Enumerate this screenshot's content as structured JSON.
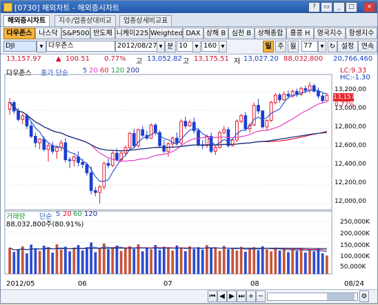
{
  "window": {
    "title": "[0730] 해외차트 - 해외증시차트",
    "controls": [
      "?",
      "▭",
      "_",
      "□",
      "×"
    ]
  },
  "tabs": [
    {
      "label": "해외증시차트",
      "active": true
    },
    {
      "label": "지수/업종상대비교",
      "active": false
    },
    {
      "label": "업종상세비교표",
      "active": false
    }
  ],
  "markets": [
    {
      "label": "다우존스",
      "selected": true
    },
    {
      "label": "나스닥"
    },
    {
      "label": "S&P500"
    },
    {
      "label": "반도체"
    },
    {
      "label": "니케이225"
    },
    {
      "label": "Weighted"
    },
    {
      "label": "DAX"
    },
    {
      "label": "상해 B"
    },
    {
      "label": "심천 B"
    },
    {
      "label": "상해종합"
    },
    {
      "label": "홍콩 H"
    },
    {
      "label": "영국지수"
    },
    {
      "label": "항셍지수"
    }
  ],
  "toolbar": {
    "symbol_code": "DJI",
    "symbol_name": "다우존스",
    "date": "2012/08/27",
    "period": "분",
    "minutes": "10",
    "count": "160",
    "day": "일",
    "week": "주",
    "month": "월",
    "span": "77",
    "settings": "설정",
    "continuous": "연속"
  },
  "quote": {
    "price": "13,157.97",
    "change": "100.51",
    "change_pct": "0.77%",
    "high_label": "고",
    "high": "13,052.82",
    "open_label": "고",
    "open": "13,175.51",
    "low_label": "저",
    "low": "13,027.20",
    "value": "88,032,800",
    "volume": "20,766,460"
  },
  "price_panel": {
    "legend_title": "다우존스",
    "legend_type": "종가 단순",
    "ma": [
      {
        "period": "5",
        "color": "#2b57c8"
      },
      {
        "period": "20",
        "color": "#e040c0"
      },
      {
        "period": "60",
        "color": "#e3132b"
      },
      {
        "period": "120",
        "color": "#1a9a3a"
      },
      {
        "period": "200",
        "color": "#1a2a8a"
      }
    ],
    "lc": "LC:9.33",
    "hc": "HC:-1.30",
    "last_tag": "13,157.97",
    "last_pct": "0.77%",
    "ticks": [
      "13,200,00",
      "13,000,00",
      "12,800,00",
      "12,600,00",
      "12,400,00",
      "12,200,00",
      "12,000,00"
    ]
  },
  "volume_panel": {
    "legend_title": "거래량",
    "legend_type": "단순",
    "ma": [
      {
        "period": "5",
        "color": "#2b57c8"
      },
      {
        "period": "20",
        "color": "#e3132b"
      },
      {
        "period": "60",
        "color": "#1a9a3a"
      },
      {
        "period": "120",
        "color": "#1a2a8a"
      }
    ],
    "info": "88,032,800주(80.91%)",
    "ticks": [
      "250,000K",
      "200,000K",
      "150,000K",
      "100,000K",
      "50,000K"
    ]
  },
  "xaxis": {
    "labels": [
      "2012/05",
      "06",
      "07",
      "08"
    ],
    "end": "08/24"
  },
  "chart_data": [
    {
      "type": "candlestick",
      "title": "다우존스",
      "ylim": [
        11950,
        13350
      ],
      "candles": [
        [
          13010,
          13130,
          12950,
          13080
        ],
        [
          13080,
          13100,
          12960,
          12990
        ],
        [
          12990,
          13020,
          12880,
          12900
        ],
        [
          12900,
          12960,
          12850,
          12940
        ],
        [
          12940,
          12960,
          12800,
          12830
        ],
        [
          12830,
          12880,
          12700,
          12720
        ],
        [
          12720,
          12760,
          12600,
          12650
        ],
        [
          12650,
          12700,
          12580,
          12690
        ],
        [
          12690,
          12720,
          12560,
          12580
        ],
        [
          12580,
          12650,
          12450,
          12620
        ],
        [
          12620,
          12660,
          12530,
          12560
        ],
        [
          12560,
          12620,
          12480,
          12600
        ],
        [
          12600,
          12680,
          12560,
          12650
        ],
        [
          12650,
          12700,
          12440,
          12470
        ],
        [
          12470,
          12500,
          12380,
          12460
        ],
        [
          12460,
          12520,
          12400,
          12500
        ],
        [
          12500,
          12560,
          12400,
          12440
        ],
        [
          12440,
          12480,
          12380,
          12420
        ],
        [
          12420,
          12440,
          12300,
          12330
        ],
        [
          12330,
          12400,
          12100,
          12140
        ],
        [
          12140,
          12180,
          12080,
          12120
        ],
        [
          12120,
          12200,
          12000,
          12180
        ],
        [
          12180,
          12450,
          12150,
          12430
        ],
        [
          12430,
          12480,
          12380,
          12410
        ],
        [
          12410,
          12560,
          12390,
          12540
        ],
        [
          12540,
          12590,
          12450,
          12470
        ],
        [
          12470,
          12560,
          12440,
          12540
        ],
        [
          12540,
          12620,
          12520,
          12600
        ],
        [
          12600,
          12770,
          12580,
          12750
        ],
        [
          12750,
          12800,
          12600,
          12620
        ],
        [
          12620,
          12800,
          12600,
          12790
        ],
        [
          12790,
          12830,
          12710,
          12730
        ],
        [
          12730,
          12780,
          12680,
          12700
        ],
        [
          12700,
          12860,
          12690,
          12840
        ],
        [
          12840,
          12860,
          12730,
          12760
        ],
        [
          12760,
          12780,
          12600,
          12620
        ],
        [
          12620,
          12680,
          12540,
          12560
        ],
        [
          12560,
          12660,
          12500,
          12640
        ],
        [
          12640,
          12720,
          12600,
          12700
        ],
        [
          12700,
          12760,
          12620,
          12650
        ],
        [
          12650,
          12900,
          12630,
          12880
        ],
        [
          12880,
          12930,
          12800,
          12830
        ],
        [
          12830,
          12900,
          12820,
          12870
        ],
        [
          12870,
          12920,
          12750,
          12780
        ],
        [
          12780,
          12800,
          12610,
          12630
        ],
        [
          12630,
          12680,
          12580,
          12620
        ],
        [
          12620,
          12740,
          12600,
          12720
        ],
        [
          12720,
          12760,
          12540,
          12560
        ],
        [
          12560,
          12620,
          12520,
          12600
        ],
        [
          12600,
          12780,
          12590,
          12760
        ],
        [
          12760,
          12830,
          12740,
          12790
        ],
        [
          12790,
          12820,
          12600,
          12620
        ],
        [
          12620,
          12690,
          12610,
          12680
        ],
        [
          12680,
          12900,
          12660,
          12880
        ],
        [
          12880,
          12960,
          12860,
          12940
        ],
        [
          12940,
          12980,
          12780,
          12800
        ],
        [
          12800,
          12860,
          12760,
          12840
        ],
        [
          12840,
          13080,
          12830,
          13050
        ],
        [
          13050,
          13120,
          12960,
          12990
        ],
        [
          12990,
          13000,
          12800,
          12820
        ],
        [
          12820,
          12900,
          12780,
          12890
        ],
        [
          12890,
          13100,
          12870,
          13080
        ],
        [
          13080,
          13180,
          13060,
          13160
        ],
        [
          13160,
          13180,
          13080,
          13110
        ],
        [
          13110,
          13200,
          13100,
          13170
        ],
        [
          13170,
          13210,
          13120,
          13150
        ],
        [
          13150,
          13220,
          13130,
          13200
        ],
        [
          13200,
          13230,
          13140,
          13170
        ],
        [
          13170,
          13250,
          13150,
          13230
        ],
        [
          13230,
          13260,
          13180,
          13210
        ],
        [
          13210,
          13300,
          13180,
          13260
        ],
        [
          13260,
          13280,
          13190,
          13200
        ],
        [
          13200,
          13240,
          13120,
          13150
        ],
        [
          13150,
          13180,
          13080,
          13100
        ],
        [
          13100,
          13180,
          13090,
          13158
        ]
      ]
    },
    {
      "type": "bar",
      "title": "거래량",
      "unit": "K",
      "ylim": [
        0,
        290000
      ],
      "values": [
        125000,
        105000,
        118000,
        132000,
        98000,
        140000,
        120000,
        110000,
        135000,
        128000,
        102000,
        142000,
        116000,
        130000,
        108000,
        125000,
        138000,
        112000,
        128000,
        150000,
        104000,
        122000,
        146000,
        118000,
        128000,
        135000,
        110000,
        124000,
        132000,
        120000,
        142000,
        108000,
        126000,
        118000,
        138000,
        114000,
        130000,
        122000,
        112000,
        136000,
        124000,
        109000,
        132000,
        120000,
        128000,
        116000,
        138000,
        122000,
        126000,
        110000,
        134000,
        118000,
        124000,
        112000,
        130000,
        106000,
        120000,
        128000,
        114000,
        132000,
        118000,
        108000,
        126000,
        112000,
        120000,
        104000,
        118000,
        110000,
        124000,
        102000,
        116000,
        108000,
        120000,
        98000,
        88033
      ]
    }
  ]
}
